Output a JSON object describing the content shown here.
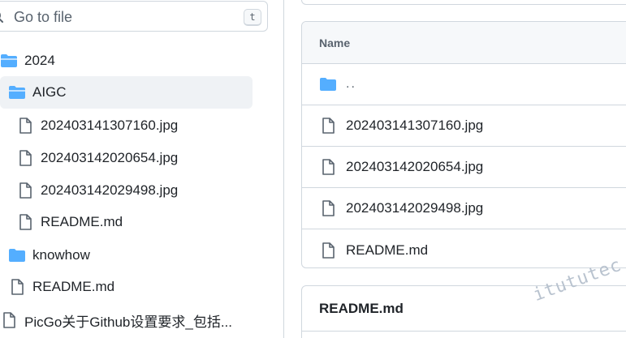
{
  "sidebar": {
    "search": {
      "placeholder": "Go to file",
      "shortcut": "t"
    },
    "tree": [
      {
        "label": "2024",
        "icon": "folder-open-icon"
      },
      {
        "label": "AIGC",
        "icon": "folder-open-icon",
        "selected": true
      },
      {
        "label": "202403141307160.jpg",
        "icon": "file-icon"
      },
      {
        "label": "202403142020654.jpg",
        "icon": "file-icon"
      },
      {
        "label": "202403142029498.jpg",
        "icon": "file-icon"
      },
      {
        "label": "README.md",
        "icon": "file-icon"
      },
      {
        "label": "knowhow",
        "icon": "folder-icon"
      },
      {
        "label": "README.md",
        "icon": "file-icon"
      },
      {
        "label": "PicGo关于Github设置要求_包括...",
        "icon": "file-icon"
      }
    ]
  },
  "files": {
    "header": "Name",
    "rows": [
      {
        "label": "..",
        "icon": "folder-icon"
      },
      {
        "label": "202403141307160.jpg",
        "icon": "file-icon"
      },
      {
        "label": "202403142020654.jpg",
        "icon": "file-icon"
      },
      {
        "label": "202403142029498.jpg",
        "icon": "file-icon"
      },
      {
        "label": "README.md",
        "icon": "file-icon"
      }
    ]
  },
  "readme": {
    "title": "README.md"
  },
  "watermark": "itututec",
  "colors": {
    "folder": "#54aeff",
    "icon_gray": "#59636e",
    "border": "#d0d7de",
    "header_bg": "#f6f8fa",
    "selected_bg": "#eff2f5"
  }
}
